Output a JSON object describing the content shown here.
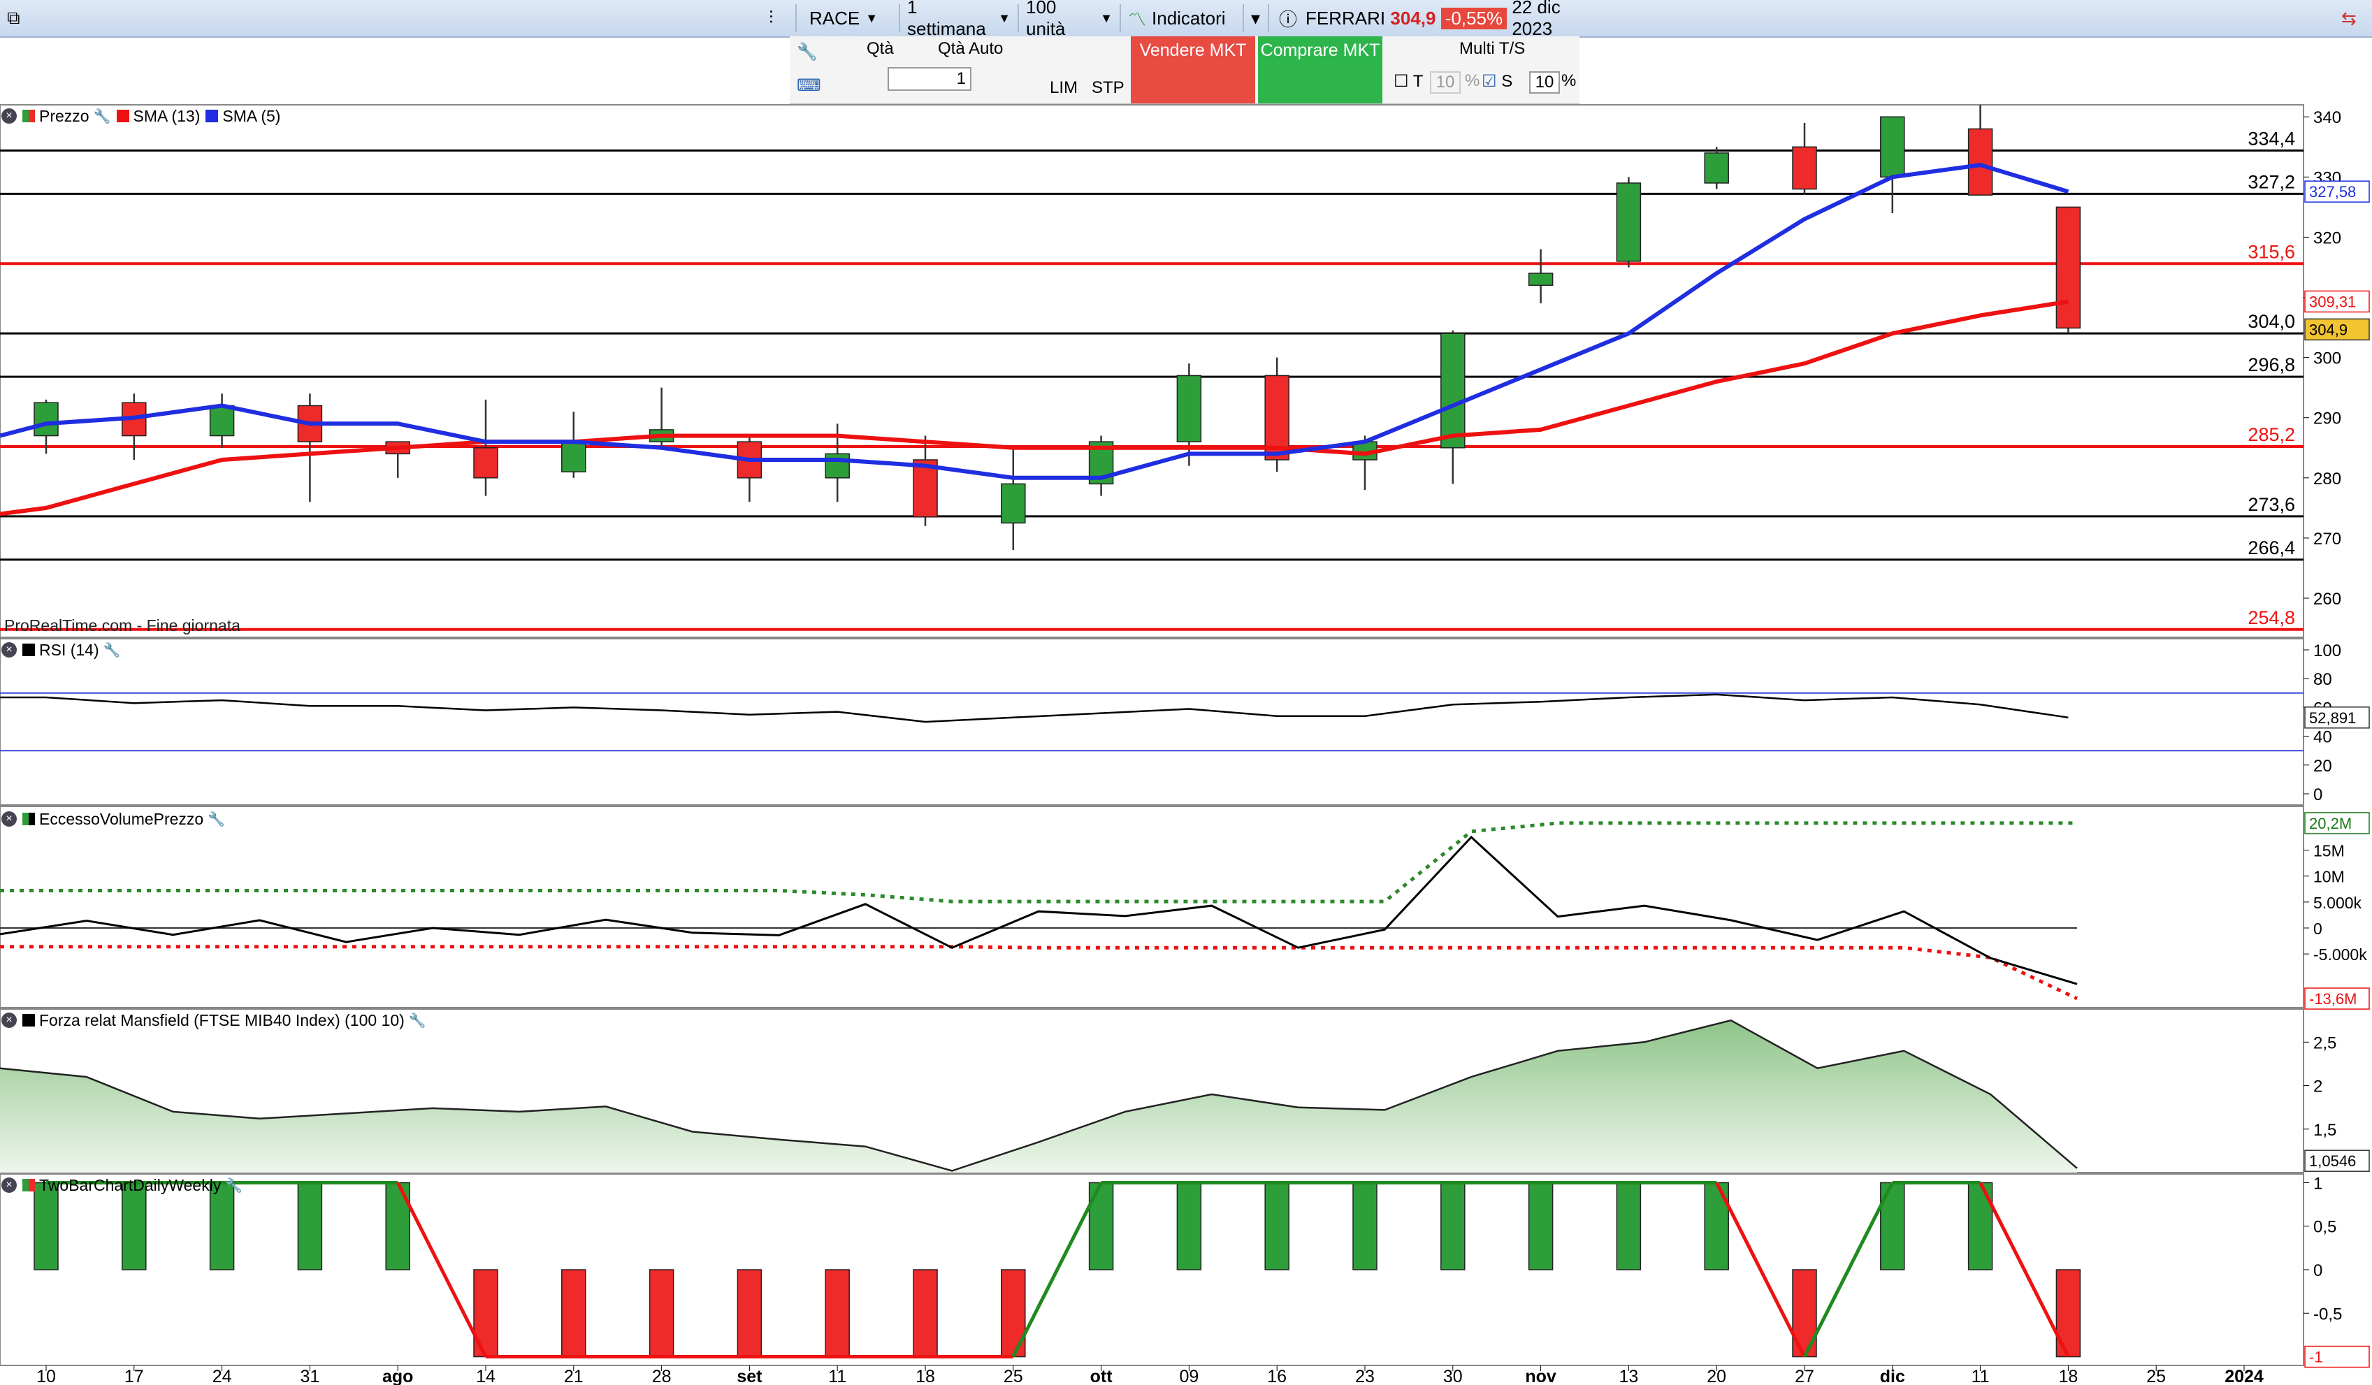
{
  "toolbar": {
    "symbol": "RACE",
    "period": "1 settimana",
    "units": "100 unità",
    "indicators": "Indicatori",
    "name": "FERRARI",
    "price": "304,9",
    "change": "-0,55%",
    "date": "22 dic 2023"
  },
  "order": {
    "qty_label": "Qtà",
    "qty_auto_label": "Qtà Auto",
    "qty_value": "1",
    "lim_label": "LIM",
    "stp_label": "STP",
    "sell_label": "Vendere MKT",
    "buy_label": "Comprare MKT",
    "multi_label": "Multi T/S",
    "t_label": "T",
    "t_value": "10",
    "s_label": "S",
    "s_value": "10",
    "pct": "%"
  },
  "watermark": "ProRealTime.com - Fine giornata",
  "legends": {
    "price": [
      "Prezzo",
      "SMA (13)",
      "SMA (5)"
    ],
    "rsi": "RSI (14)",
    "evp": "EccessoVolumePrezzo",
    "mansfield": "Forza relat Mansfield (FTSE MIB40 Index) (100 10)",
    "twobar": "TwoBarChartDailyWeekly"
  },
  "colors": {
    "up": "#2e9e3a",
    "down": "#ee2a2a",
    "sma13": "#ee1111",
    "sma5": "#1f2ee0",
    "area_fill": "#cfe5cc"
  },
  "chart_data": [
    {
      "type": "candlestick",
      "panel": "price",
      "x": [
        "10",
        "17",
        "24",
        "31",
        "ago",
        "14",
        "21",
        "28",
        "set",
        "11",
        "18",
        "25",
        "ott",
        "09",
        "16",
        "23",
        "30",
        "nov",
        "13",
        "20",
        "27",
        "dic",
        "11",
        "18",
        "25",
        "2024"
      ],
      "ohlc": [
        [
          287,
          293,
          284,
          292.5
        ],
        [
          292.5,
          294,
          283,
          287
        ],
        [
          287,
          294,
          285,
          292
        ],
        [
          292,
          294,
          276,
          286
        ],
        [
          286,
          286,
          280,
          284
        ],
        [
          285,
          293,
          277,
          280
        ],
        [
          281,
          291,
          280,
          286
        ],
        [
          286,
          295,
          285,
          288
        ],
        [
          286,
          287,
          276,
          280
        ],
        [
          280,
          289,
          276,
          284
        ],
        [
          283,
          287,
          272,
          273.5
        ],
        [
          272.5,
          285,
          268,
          279
        ],
        [
          279,
          287,
          277,
          286
        ],
        [
          286,
          299,
          282,
          297
        ],
        [
          297,
          300,
          281,
          283
        ],
        [
          283,
          287,
          278,
          286
        ],
        [
          285,
          304.5,
          279,
          304
        ],
        [
          312,
          318,
          309,
          314
        ],
        [
          316,
          330,
          315,
          329
        ],
        [
          329,
          335,
          328,
          334
        ],
        [
          335,
          339,
          327,
          328
        ],
        [
          330,
          340,
          324,
          340
        ],
        [
          338,
          342,
          327,
          327
        ],
        [
          325,
          325,
          304,
          304.9
        ]
      ],
      "sma13": [
        275,
        279,
        283,
        284,
        285,
        286,
        286,
        287,
        287,
        287,
        286,
        285,
        285,
        285,
        285,
        284,
        287,
        288,
        292,
        296,
        299,
        304,
        307,
        309.31
      ],
      "sma5": [
        289,
        290,
        292,
        289,
        289,
        286,
        286,
        285,
        283,
        283,
        282,
        280,
        280,
        284,
        284,
        286,
        292,
        298,
        304,
        314,
        323,
        330,
        332,
        327.58
      ],
      "hlines": [
        334.4,
        327.2,
        315.6,
        304.0,
        296.8,
        285.2,
        273.6,
        266.4,
        254.8
      ],
      "hline_labels": [
        "334,4",
        "327,2",
        "315,6",
        "304,0",
        "296,8",
        "285,2",
        "273,6",
        "266,4",
        "254,8"
      ],
      "yticks": [
        340,
        330,
        320,
        310,
        300,
        290,
        280,
        270,
        260
      ],
      "ytick_labels": [
        "340",
        "330",
        "320",
        "",
        "300",
        "290",
        "280",
        "270",
        "260"
      ],
      "ylim": [
        253.5,
        342
      ],
      "value_labels": [
        "327,58",
        "309,31",
        "304,9"
      ]
    },
    {
      "type": "line",
      "panel": "rsi",
      "values": [
        67,
        63,
        65,
        61,
        61,
        58,
        60,
        58,
        55,
        57,
        50,
        53,
        56,
        59,
        54,
        54,
        62,
        64,
        67,
        69,
        65,
        67,
        62,
        53
      ],
      "hlines": [
        70,
        30
      ],
      "yticks": [
        100,
        80,
        60,
        40,
        20,
        0
      ],
      "ytick_labels": [
        "100",
        "80",
        "60",
        "40",
        "20",
        "0"
      ],
      "ylim": [
        0,
        100
      ],
      "value_label": "52,891"
    },
    {
      "type": "line",
      "panel": "evp",
      "series": [
        {
          "values": [
            -1.2,
            1.4,
            -1.3,
            1.5,
            -2.7,
            0,
            -1.3,
            1.6,
            -0.9,
            -1.4,
            4.6,
            -3.8,
            3.2,
            2.3,
            4.3,
            -3.8,
            -0.3,
            17.5,
            2.2,
            4.3,
            1.5,
            -2.3,
            3.2,
            -5.8,
            -10.8
          ]
        },
        {
          "values": [
            7.2,
            7.2,
            7.2,
            7.2,
            7.2,
            7.2,
            7.2,
            7.2,
            7.2,
            7.2,
            6.4,
            5.1,
            5.1,
            5.1,
            5.1,
            5.1,
            5.1,
            18.6,
            20.2,
            20.2,
            20.2,
            20.2,
            20.2,
            20.2,
            20.2
          ]
        },
        {
          "values": [
            -3.6,
            -3.6,
            -3.6,
            -3.6,
            -3.6,
            -3.6,
            -3.6,
            -3.6,
            -3.6,
            -3.6,
            -3.6,
            -3.6,
            -3.8,
            -3.8,
            -3.8,
            -3.8,
            -3.8,
            -3.8,
            -3.8,
            -3.8,
            -3.8,
            -3.8,
            -3.8,
            -5.7,
            -13.6
          ]
        }
      ],
      "yticks": [
        15,
        10,
        5,
        0,
        -5
      ],
      "ytick_labels": [
        "15M",
        "10M",
        "5.000k",
        "0",
        "-5.000k"
      ],
      "ylim": [
        -14,
        21
      ],
      "value_labels": [
        "20,2M",
        "-13,6M"
      ]
    },
    {
      "type": "area",
      "panel": "mansfield",
      "values": [
        2.2,
        2.1,
        1.7,
        1.62,
        1.68,
        1.74,
        1.7,
        1.76,
        1.47,
        1.38,
        1.3,
        1.02,
        1.35,
        1.7,
        1.9,
        1.75,
        1.72,
        2.1,
        2.4,
        2.5,
        2.75,
        2.2,
        2.4,
        1.9,
        1.05
      ],
      "yticks": [
        2.5,
        2,
        1.5
      ],
      "ytick_labels": [
        "2,5",
        "2",
        "1,5"
      ],
      "ylim": [
        1.0,
        2.8
      ],
      "value_label": "1,0546"
    },
    {
      "type": "bar",
      "panel": "twobar",
      "values": [
        1,
        1,
        1,
        1,
        1,
        -1,
        -1,
        -1,
        -1,
        -1,
        -1,
        -1,
        1,
        1,
        1,
        1,
        1,
        1,
        1,
        1,
        -1,
        1,
        1,
        -1
      ],
      "yticks": [
        1,
        0.5,
        0,
        -0.5
      ],
      "ytick_labels": [
        "1",
        "0,5",
        "0",
        "-0,5"
      ],
      "ylim": [
        -1.1,
        1.1
      ],
      "value_label": "-1"
    }
  ]
}
